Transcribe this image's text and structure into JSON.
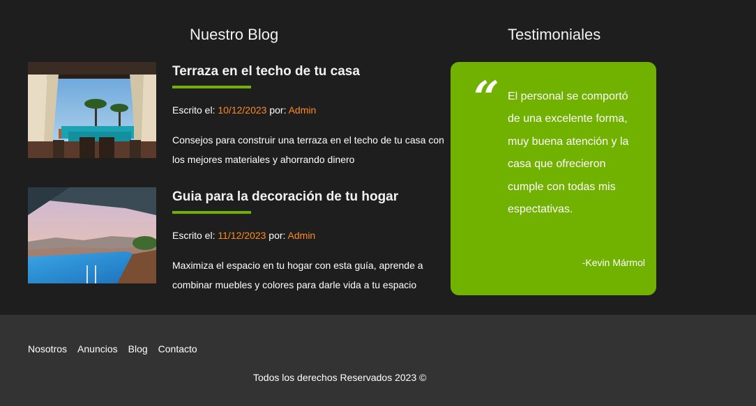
{
  "blog": {
    "title": "Nuestro Blog",
    "posts": [
      {
        "title": "Terraza en el techo de tu casa",
        "written_label": "Escrito el:",
        "date": "10/12/2023",
        "by_label": "por:",
        "author": "Admin",
        "excerpt": "Consejos para construir una terraza en el techo de tu casa con los mejores materiales y ahorrando dinero"
      },
      {
        "title": "Guia para la decoración de tu hogar",
        "written_label": "Escrito el:",
        "date": "11/12/2023",
        "by_label": "por:",
        "author": "Admin",
        "excerpt": "Maximiza el espacio en tu hogar con esta guía, aprende a combinar muebles y colores para darle vida a tu espacio"
      }
    ]
  },
  "testimonials": {
    "title": "Testimoniales",
    "quote_mark": "“",
    "text": "El personal se comportó de una excelente forma, muy buena atención y la casa que ofrecieron cumple con todas mis espectativas.",
    "author": "-Kevin Mármol"
  },
  "footer": {
    "nav": [
      "Nosotros",
      "Anuncios",
      "Blog",
      "Contacto"
    ],
    "copyright": "Todos los derechos Reservados 2023 ©"
  },
  "colors": {
    "background": "#1e1e1f",
    "footer": "#333334",
    "accent_green": "#71b100",
    "accent_orange": "#ff8a1e"
  }
}
